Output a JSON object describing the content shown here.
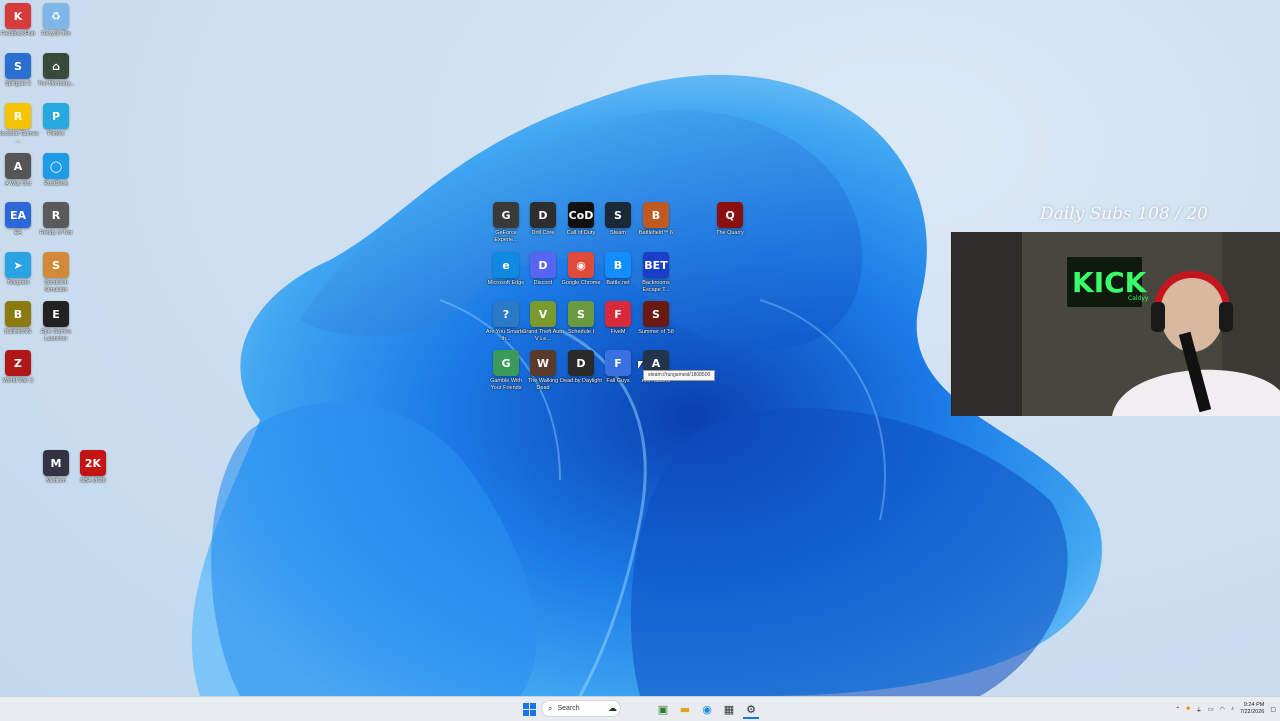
{
  "overlay": {
    "subs_goal": "Daily Subs 108 / 20"
  },
  "webcam": {
    "brand": "KICK",
    "handle": "Caldyy"
  },
  "tooltip": "steam://rungameid/1808500",
  "desktop_left": [
    {
      "label": "FeedbackHub",
      "color": "#d83b3b",
      "glyph": "K"
    },
    {
      "label": "Recycle Bin",
      "color": "#7fb6e8",
      "glyph": "♻"
    },
    {
      "label": "Splitgate 2",
      "color": "#2b6fd0",
      "glyph": "S"
    },
    {
      "label": "The Mortuary...",
      "color": "#3a4a3a",
      "glyph": "⌂"
    },
    {
      "label": "Rockstar Games ...",
      "color": "#f5c400",
      "glyph": "R"
    },
    {
      "label": "Parsec",
      "color": "#28a8e0",
      "glyph": "P"
    },
    {
      "label": "A Way Out",
      "color": "#555",
      "glyph": "A"
    },
    {
      "label": "RustDesk",
      "color": "#1e9be6",
      "glyph": "◯"
    },
    {
      "label": "EA",
      "color": "#2d68d8",
      "glyph": "EA"
    },
    {
      "label": "Ready or Not",
      "color": "#5a5a5a",
      "glyph": "R"
    },
    {
      "label": "Telegram",
      "color": "#29a3e1",
      "glyph": "➤"
    },
    {
      "label": "Sandwich Simulator",
      "color": "#d28a3a",
      "glyph": "S"
    },
    {
      "label": "BallisticNG",
      "color": "#8a7a10",
      "glyph": "B"
    },
    {
      "label": "Epic Games Launcher",
      "color": "#222",
      "glyph": "E"
    },
    {
      "label": "World War Z",
      "color": "#b01818",
      "glyph": "Z"
    },
    {
      "label": "Medium",
      "color": "#334",
      "glyph": "M"
    },
    {
      "label": "NBA 2K26",
      "color": "#c31313",
      "glyph": "2K"
    }
  ],
  "desktop_center": [
    {
      "label": "GeForce Experie...",
      "color": "#3a3a3a",
      "glyph": "G"
    },
    {
      "label": "Drill Core",
      "color": "#2e2e2e",
      "glyph": "D"
    },
    {
      "label": "Call of Duty",
      "color": "#111",
      "glyph": "CoD"
    },
    {
      "label": "Steam",
      "color": "#1b2838",
      "glyph": "S"
    },
    {
      "label": "Battlefield™ 6",
      "color": "#c05a20",
      "glyph": "B"
    },
    {
      "label": "The Quarry",
      "color": "#8a1010",
      "glyph": "Q"
    },
    {
      "label": "Microsoft Edge",
      "color": "#0f8ae0",
      "glyph": "e"
    },
    {
      "label": "Discord",
      "color": "#5865f2",
      "glyph": "D"
    },
    {
      "label": "Google Chrome",
      "color": "#e04a3a",
      "glyph": "◉"
    },
    {
      "label": "Battle.net",
      "color": "#148eff",
      "glyph": "B"
    },
    {
      "label": "Backrooms Escape T...",
      "color": "#1a3ec8",
      "glyph": "BET"
    },
    {
      "label": "Are You Smarter th...",
      "color": "#2a7ac8",
      "glyph": "?"
    },
    {
      "label": "Grand Theft Auto V Le...",
      "color": "#7a9a30",
      "glyph": "V"
    },
    {
      "label": "Schedule I",
      "color": "#6a9a40",
      "glyph": "S"
    },
    {
      "label": "FiveM",
      "color": "#d82a3a",
      "glyph": "F"
    },
    {
      "label": "Summer of '58",
      "color": "#6a1a10",
      "glyph": "S"
    },
    {
      "label": "Gamble With Your Friends",
      "color": "#3a9a5a",
      "glyph": "G"
    },
    {
      "label": "The Walking Dead",
      "color": "#5a3a2a",
      "glyph": "W"
    },
    {
      "label": "Dead by Daylight",
      "color": "#2a2a2a",
      "glyph": "D"
    },
    {
      "label": "Fall Guys",
      "color": "#3a70e0",
      "glyph": "F"
    },
    {
      "label": "Arc Raiders",
      "color": "#22354a",
      "glyph": "A"
    }
  ],
  "taskbar": {
    "search_label": "Search",
    "time": "9:24 PM",
    "date": "7/22/2026"
  }
}
